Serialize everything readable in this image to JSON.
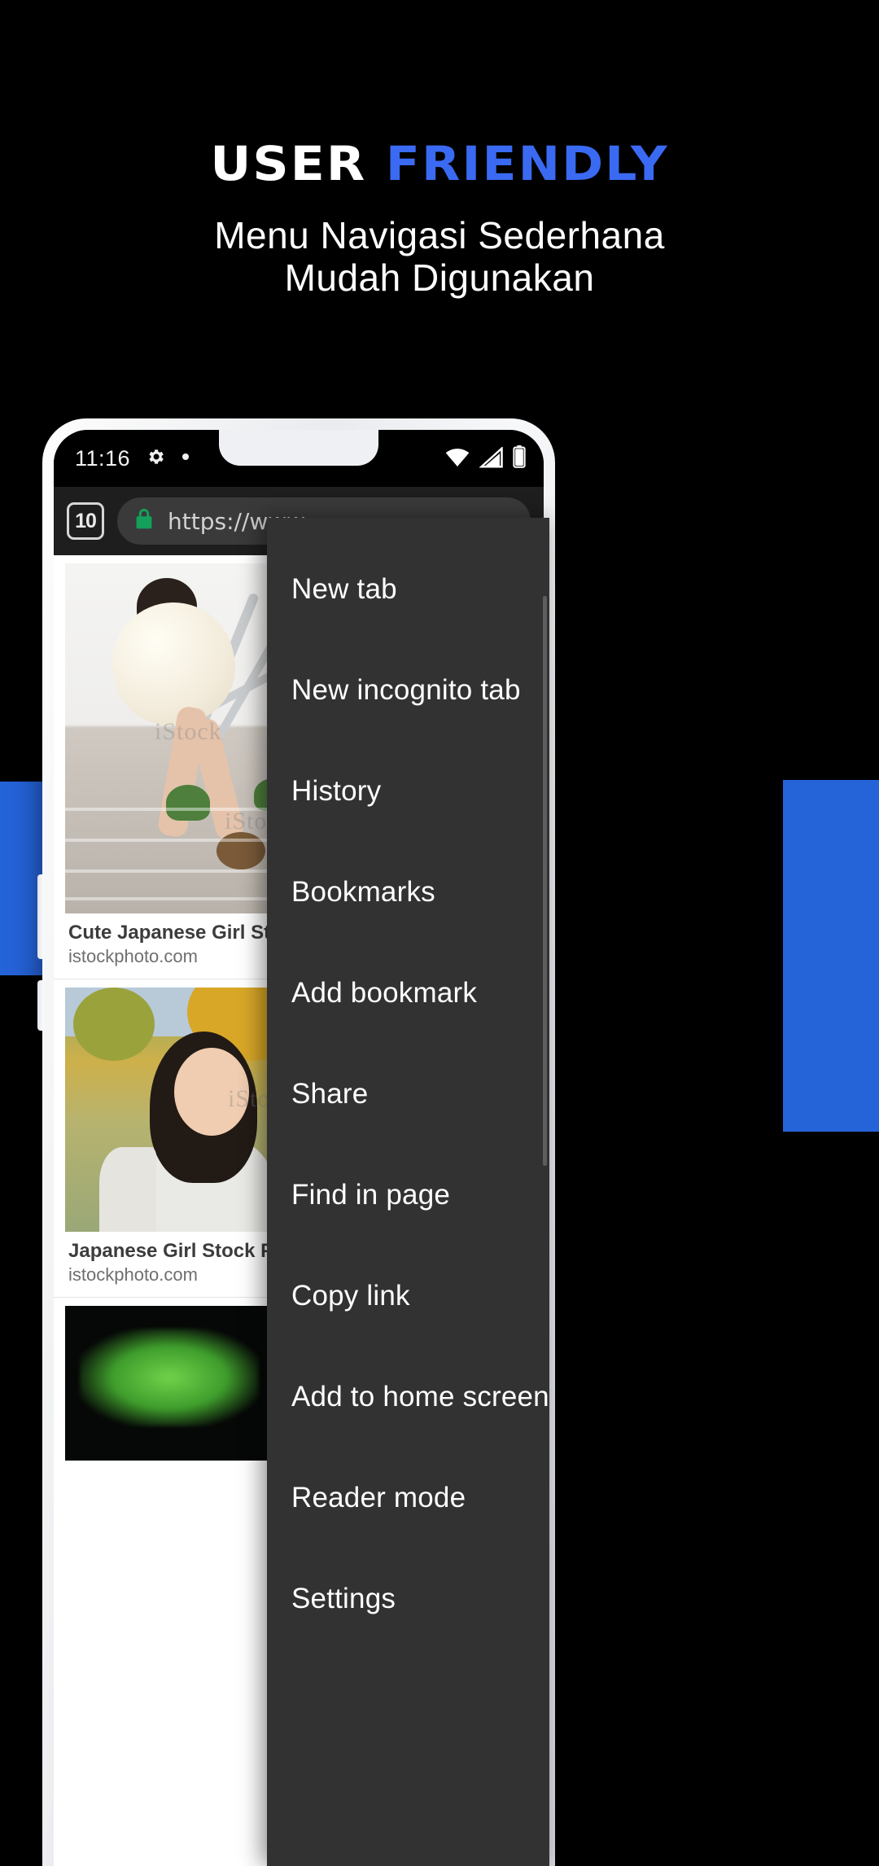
{
  "promo": {
    "logo": {
      "first": "USER",
      "second": "FRIENDLY",
      "accent_color": "#3a6af2"
    },
    "subtitle_line1": "Menu Navigasi Sederhana",
    "subtitle_line2": "Mudah Digunakan",
    "background_color": "#000000",
    "band_color": "#2563d9"
  },
  "phone": {
    "status_bar": {
      "time": "11:16",
      "icons": [
        "gear-icon",
        "dot-icon",
        "wifi-icon",
        "signal-icon",
        "battery-icon"
      ]
    },
    "browser": {
      "tab_count": "10",
      "url": "https://www",
      "lock_color": "#14a05a",
      "toolbar_bg": "#1e1e1e"
    },
    "results": [
      {
        "title": "Cute Japanese Girl Stock Photo",
        "source": "istockphoto.com",
        "watermark": "iStock"
      },
      {
        "title": "Japanese Girl Stock Photo - Do",
        "source": "istockphoto.com",
        "watermark": "iStock"
      }
    ]
  },
  "menu": {
    "background_color": "#323232",
    "items": [
      {
        "label": "New tab"
      },
      {
        "label": "New incognito tab"
      },
      {
        "label": "History"
      },
      {
        "label": "Bookmarks"
      },
      {
        "label": "Add bookmark"
      },
      {
        "label": "Share"
      },
      {
        "label": "Find in page"
      },
      {
        "label": "Copy link"
      },
      {
        "label": "Add to home screen"
      },
      {
        "label": "Reader mode"
      },
      {
        "label": "Settings"
      }
    ]
  }
}
